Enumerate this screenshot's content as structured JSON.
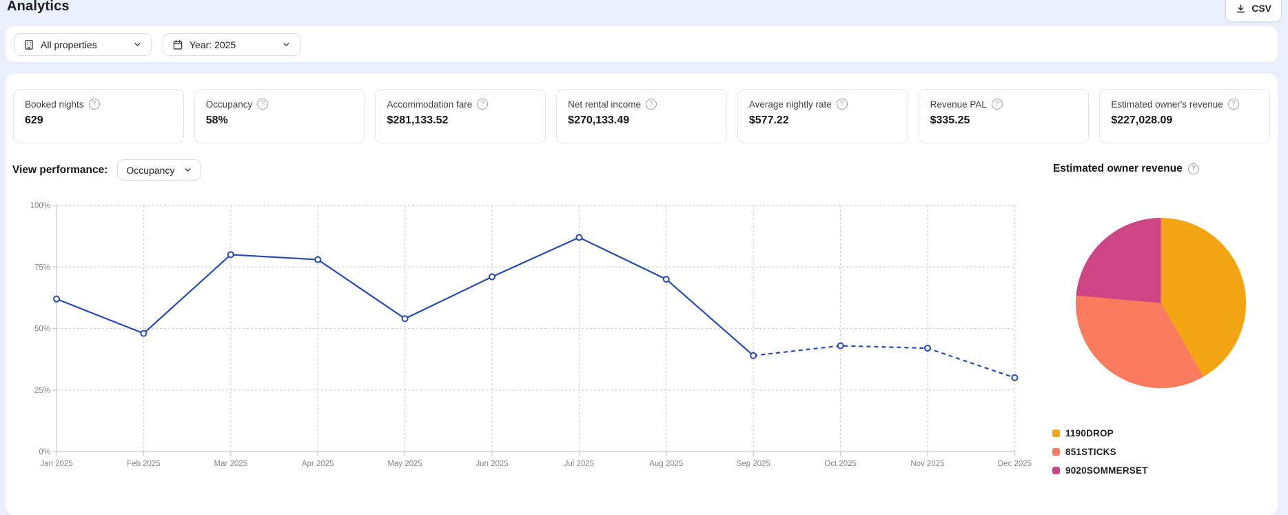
{
  "page": {
    "title": "Analytics",
    "background": "#e9f0fb"
  },
  "toolbar": {
    "csv_label": "CSV",
    "csv_icon": "download-icon"
  },
  "filters": {
    "property": {
      "value": "All properties",
      "icon": "building-icon"
    },
    "year": {
      "value": "Year: 2025",
      "icon": "calendar-icon"
    }
  },
  "kpis": [
    {
      "label": "Booked nights",
      "value": "629"
    },
    {
      "label": "Occupancy",
      "value": "58%"
    },
    {
      "label": "Accommodation fare",
      "value": "$281,133.52"
    },
    {
      "label": "Net rental income",
      "value": "$270,133.49"
    },
    {
      "label": "Average nightly rate",
      "value": "$577.22"
    },
    {
      "label": "Revenue PAL",
      "value": "$335.25"
    },
    {
      "label": "Estimated owner's revenue",
      "value": "$227,028.09"
    }
  ],
  "performance": {
    "label": "View performance:",
    "selected": "Occupancy"
  },
  "owner_revenue": {
    "title": "Estimated owner revenue"
  },
  "colors": {
    "line_blue": "#2649b2",
    "grid_gray": "#cdd1d6",
    "axis_gray": "#c4c7cc",
    "tick_text": "#80868b"
  },
  "chart_data": [
    {
      "type": "line",
      "title": "Occupancy by month (View performance: Occupancy)",
      "x": [
        "Jan 2025",
        "Feb 2025",
        "Mar 2025",
        "Apr 2025",
        "May 2025",
        "Jun 2025",
        "Jul 2025",
        "Aug 2025",
        "Sep 2025",
        "Oct 2025",
        "Nov 2025",
        "Dec 2025"
      ],
      "values": [
        62,
        48,
        80,
        78,
        54,
        71,
        87,
        70,
        39,
        43,
        42,
        30
      ],
      "unit": "%",
      "ylim": [
        0,
        100
      ],
      "yticks": [
        0,
        25,
        50,
        75,
        100
      ],
      "ytick_labels": [
        "0%",
        "25%",
        "50%",
        "75%",
        "100%"
      ],
      "dashed_from_index": 8,
      "line_color": "#2649b2",
      "marker": "open-circle",
      "grid": true
    },
    {
      "type": "pie",
      "title": "Estimated owner revenue",
      "legend_position": "bottom-left",
      "slices": [
        {
          "label": "1190DROP",
          "color": "#F2A413",
          "percent": 41.7
        },
        {
          "label": "851STICKS",
          "color": "#F87A5F",
          "percent": 34.7
        },
        {
          "label": "9020SOMMERSET",
          "color": "#CE4586",
          "percent": 23.6
        }
      ]
    }
  ]
}
